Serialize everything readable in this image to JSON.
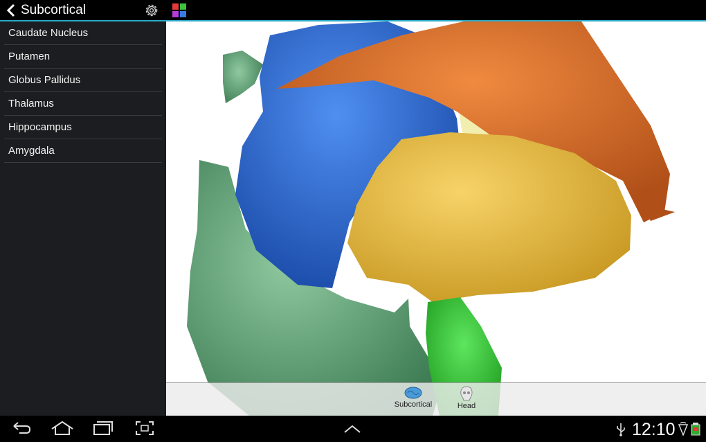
{
  "header": {
    "title": "Subcortical"
  },
  "sidebar": {
    "items": [
      {
        "label": "Caudate Nucleus"
      },
      {
        "label": "Putamen"
      },
      {
        "label": "Globus Pallidus"
      },
      {
        "label": "Thalamus"
      },
      {
        "label": "Hippocampus"
      },
      {
        "label": "Amygdala"
      }
    ]
  },
  "tabs": [
    {
      "label": "Subcortical",
      "icon": "brain-icon"
    },
    {
      "label": "Head",
      "icon": "skull-icon"
    }
  ],
  "status": {
    "time": "12:10"
  },
  "colors": {
    "accent": "#2aa8c8",
    "caudate": "#2e6fd0",
    "putamen": "#e2722e",
    "globus_pallidus": "#f0c24a",
    "thalamus": "#f2eeb0",
    "hippocampus": "#5aa070",
    "amygdala": "#33cc33"
  }
}
